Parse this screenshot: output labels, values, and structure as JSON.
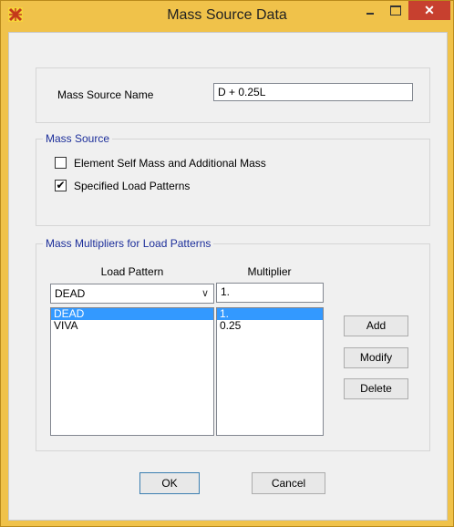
{
  "window": {
    "title": "Mass Source Data"
  },
  "mass_source_name": {
    "label": "Mass Source Name",
    "value": "D + 0.25L"
  },
  "mass_source": {
    "group_title": "Mass Source",
    "options": [
      {
        "label": "Element Self Mass and Additional Mass",
        "checked": false
      },
      {
        "label": "Specified Load Patterns",
        "checked": true
      }
    ]
  },
  "multipliers": {
    "group_title": "Mass Multipliers for Load Patterns",
    "load_pattern_header": "Load Pattern",
    "multiplier_header": "Multiplier",
    "load_pattern_selected": "DEAD",
    "multiplier_value": "1.",
    "rows": [
      {
        "load_pattern": "DEAD",
        "multiplier": "1."
      },
      {
        "load_pattern": "VIVA",
        "multiplier": "0.25"
      }
    ],
    "buttons": {
      "add": "Add",
      "modify": "Modify",
      "delete": "Delete"
    }
  },
  "footer": {
    "ok": "OK",
    "cancel": "Cancel"
  },
  "icons": {
    "app": "sap-logo-icon",
    "minimize": "minimize-icon",
    "maximize": "maximize-icon",
    "close": "close-icon"
  },
  "colors": {
    "titlebar": "#f0c24a",
    "close_button": "#c7402f",
    "group_title": "#1c2e9a",
    "selection": "#3399ff"
  }
}
